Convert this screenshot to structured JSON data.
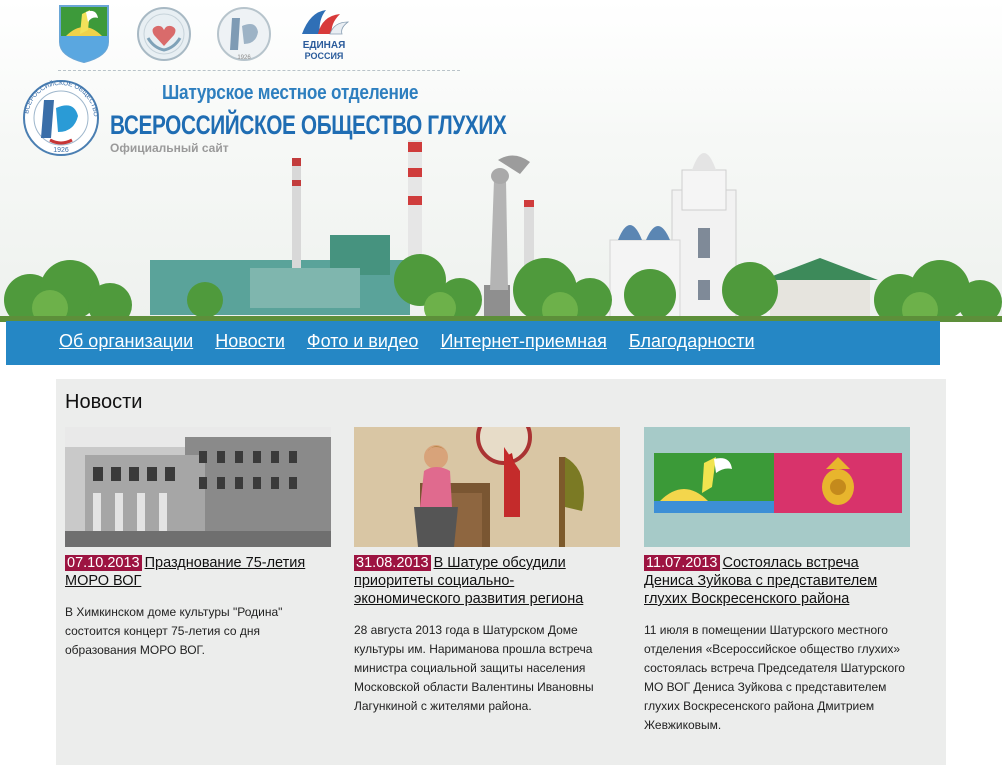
{
  "header": {
    "organization": "Шатурское местное отделение",
    "society": "ВСЕРОССИЙСКОЕ ОБЩЕСТВО ГЛУХИХ",
    "official": "Официальный сайт",
    "emblem_ring_text": "ВСЕРОССИЙСКОЕ ОБЩЕСТВО ГЛУХИХ",
    "emblem_year": "1926",
    "party_logo_text_1": "ЕДИНАЯ",
    "party_logo_text_2": "РОССИЯ",
    "logos": [
      "shatura-coat-of-arms-icon",
      "heart-hands-emblem-icon",
      "vog-emblem-icon",
      "united-russia-logo-icon"
    ]
  },
  "nav": {
    "items": [
      {
        "label": "Об организации"
      },
      {
        "label": "Новости"
      },
      {
        "label": "Фото и видео"
      },
      {
        "label": "Интернет-приемная"
      },
      {
        "label": "Благодарности"
      }
    ]
  },
  "news": {
    "heading": "Новости",
    "items": [
      {
        "date": "07.10.2013",
        "title": "Празднование 75-летия МОРО ВОГ",
        "summary": "В Химкинском доме культуры \"Родина\" состоится концерт 75-летия со дня образования МОРО ВОГ."
      },
      {
        "date": "31.08.2013",
        "title": "В Шатуре обсудили приоритеты социально-экономического развития региона",
        "summary": "28 августа 2013 года в Шатурском Доме культуры им. Нариманова прошла встреча министра социальной защиты населения Московской области Валентины Ивановны Лагункиной с жителями района."
      },
      {
        "date": "11.07.2013",
        "title": "Состоялась встреча Дениса Зуйкова с представителем глухих Воскресенского района",
        "summary": "11 июля в помещении Шатурского местного отделения «Всероссийское общество глухих» состоялась встреча Председателя Шатурского МО ВОГ Дениса Зуйкова с представителем глухих Воскресенского района Дмитрием Жевжиковым."
      }
    ]
  },
  "colors": {
    "nav_bg": "#2587c5",
    "date_badge": "#9d1441",
    "news_bg": "#ecedec",
    "title_blue": "#1f6db3"
  }
}
